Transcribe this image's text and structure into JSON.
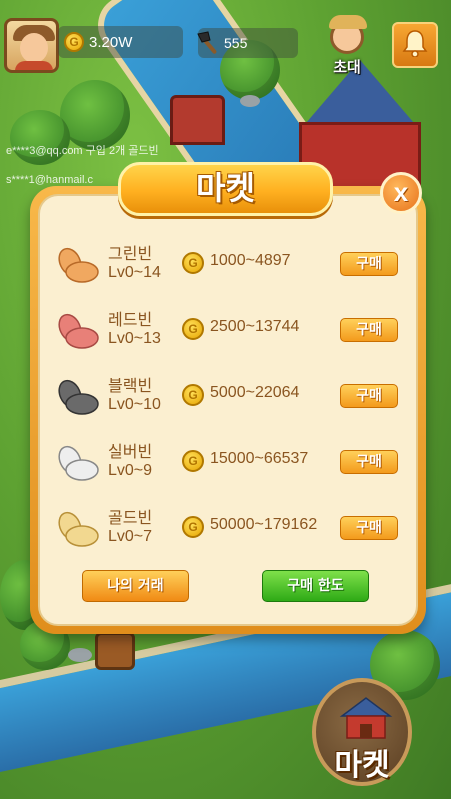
{
  "hud": {
    "coins": "3.20W",
    "coin_symbol": "G",
    "axe_count": "555",
    "invite_label": "초대"
  },
  "ticker": [
    "e****3@qq.com 구입 2개 골드빈",
    "s****1@hanmail.c"
  ],
  "market": {
    "title": "마켓",
    "close_label": "x",
    "items": [
      {
        "name": "그린빈",
        "level": "Lv0~14",
        "price": "1000~4897",
        "buy_label": "구매",
        "color": "#f0a860"
      },
      {
        "name": "레드빈",
        "level": "Lv0~13",
        "price": "2500~13744",
        "buy_label": "구매",
        "color": "#e88078"
      },
      {
        "name": "블랙빈",
        "level": "Lv0~10",
        "price": "5000~22064",
        "buy_label": "구매",
        "color": "#6a6a6a"
      },
      {
        "name": "실버빈",
        "level": "Lv0~9",
        "price": "15000~66537",
        "buy_label": "구매",
        "color": "#eeeeee"
      },
      {
        "name": "골드빈",
        "level": "Lv0~7",
        "price": "50000~179162",
        "buy_label": "구매",
        "color": "#f2d890"
      }
    ],
    "my_trades_label": "나의 거래",
    "buy_limit_label": "구매 한도"
  },
  "market_button_label": "마켓"
}
